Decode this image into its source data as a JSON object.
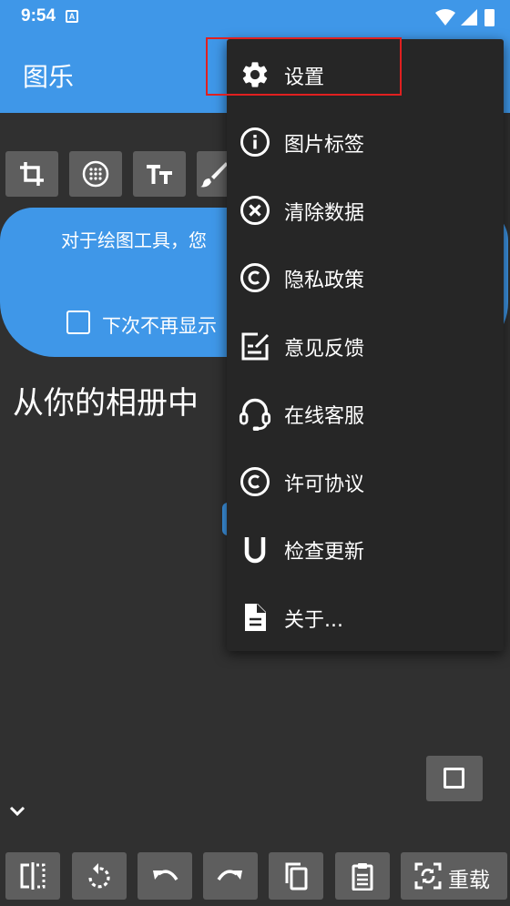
{
  "status": {
    "time": "9:54",
    "notif_letter": "A"
  },
  "app": {
    "title": "图乐"
  },
  "tip": {
    "text": "对于绘图工具，您",
    "checkbox_label": "下次不再显示"
  },
  "main": {
    "prompt": "从你的相册中"
  },
  "menu": {
    "items": [
      {
        "label": "设置",
        "icon": "gear-icon"
      },
      {
        "label": "图片标签",
        "icon": "info-icon"
      },
      {
        "label": "清除数据",
        "icon": "clear-circle-icon"
      },
      {
        "label": "隐私政策",
        "icon": "copyright-icon"
      },
      {
        "label": "意见反馈",
        "icon": "feedback-edit-icon"
      },
      {
        "label": "在线客服",
        "icon": "headset-icon"
      },
      {
        "label": "许可协议",
        "icon": "copyright-icon"
      },
      {
        "label": "检查更新",
        "icon": "update-u-icon"
      },
      {
        "label": "关于...",
        "icon": "document-icon"
      }
    ]
  },
  "bottom": {
    "reload_label": "重载"
  },
  "colors": {
    "primary": "#3f97e8",
    "background": "#303030",
    "menu": "#262626",
    "button": "#5e5e5e",
    "highlight": "#e02020"
  }
}
